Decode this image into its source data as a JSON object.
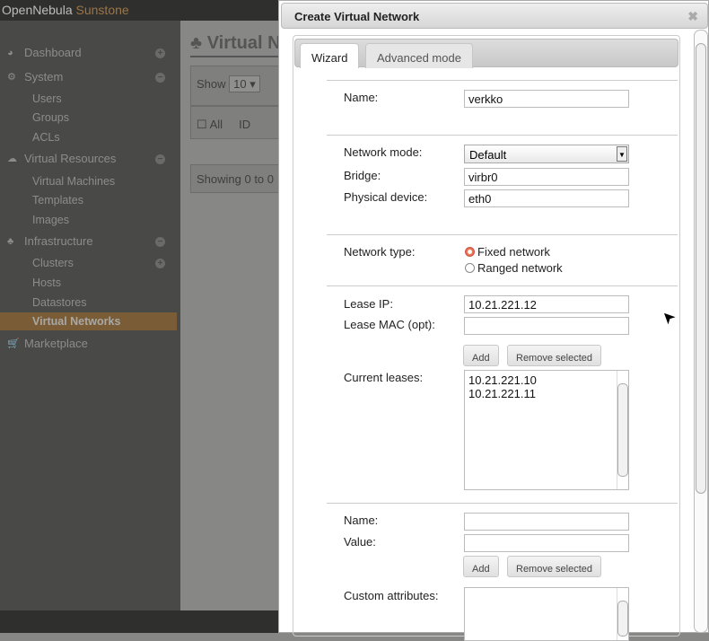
{
  "app": {
    "brand_part1": "OpenNebula",
    "brand_part2": "Sunstone"
  },
  "sidebar": {
    "items": [
      {
        "label": "Dashboard",
        "icon": "dashboard-icon",
        "toggle": "+"
      },
      {
        "label": "System",
        "icon": "gears-icon",
        "toggle": "−"
      },
      {
        "label": "Users"
      },
      {
        "label": "Groups"
      },
      {
        "label": "ACLs"
      },
      {
        "label": "Virtual Resources",
        "icon": "cloud-icon",
        "toggle": "−"
      },
      {
        "label": "Virtual Machines"
      },
      {
        "label": "Templates"
      },
      {
        "label": "Images"
      },
      {
        "label": "Infrastructure",
        "icon": "sitemap-icon",
        "toggle": "−"
      },
      {
        "label": "Clusters",
        "toggle": "+"
      },
      {
        "label": "Hosts"
      },
      {
        "label": "Datastores"
      },
      {
        "label": "Virtual Networks",
        "active": true
      },
      {
        "label": "Marketplace",
        "icon": "cart-icon"
      }
    ]
  },
  "main": {
    "title": "Virtual Networks",
    "show_label": "Show",
    "show_value": "10",
    "all_label": "All",
    "id_header": "ID",
    "showing_text": "Showing 0 to 0"
  },
  "dialog": {
    "title": "Create Virtual Network",
    "tabs": [
      {
        "label": "Wizard",
        "selected": true
      },
      {
        "label": "Advanced mode"
      }
    ],
    "name_label": "Name:",
    "name_value": "verkko",
    "network_mode_label": "Network mode:",
    "network_mode_value": "Default",
    "bridge_label": "Bridge:",
    "bridge_value": "virbr0",
    "physical_device_label": "Physical device:",
    "physical_device_value": "eth0",
    "network_type_label": "Network type:",
    "network_types": [
      {
        "label": "Fixed network",
        "checked": true
      },
      {
        "label": "Ranged network",
        "checked": false
      }
    ],
    "lease_ip_label": "Lease IP:",
    "lease_ip_value": "10.21.221.12",
    "lease_mac_label": "Lease MAC (opt):",
    "lease_mac_value": "",
    "add_label": "Add",
    "remove_label": "Remove selected",
    "current_leases_label": "Current leases:",
    "current_leases": [
      "10.21.221.10",
      "10.21.221.11"
    ],
    "attr_name_label": "Name:",
    "attr_value_label": "Value:",
    "custom_attributes_label": "Custom attributes:"
  },
  "colors": {
    "accent": "#7a5c36",
    "radio_checked": "#e8704a"
  }
}
